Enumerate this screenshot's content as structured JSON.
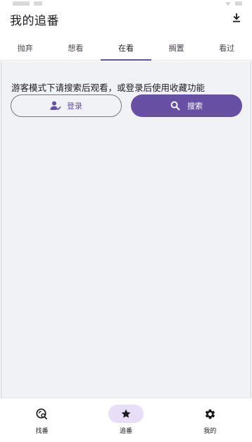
{
  "app": {
    "title": "我的追番"
  },
  "tabs": [
    {
      "label": "抛弃",
      "active": false
    },
    {
      "label": "想看",
      "active": false
    },
    {
      "label": "在看",
      "active": true
    },
    {
      "label": "搁置",
      "active": false
    },
    {
      "label": "看过",
      "active": false
    }
  ],
  "content": {
    "guest_message": "游客模式下请搜索后观看，或登录后使用收藏功能",
    "login_label": "登录",
    "search_label": "搜索"
  },
  "bottom_nav": [
    {
      "label": "找番",
      "icon": "discover-search-icon",
      "active": false
    },
    {
      "label": "追番",
      "icon": "star-icon",
      "active": true
    },
    {
      "label": "我的",
      "icon": "gear-icon",
      "active": false
    }
  ],
  "colors": {
    "accent": "#6750a4",
    "accent_container": "#e8def8",
    "content_bg": "#f1f2f5"
  }
}
